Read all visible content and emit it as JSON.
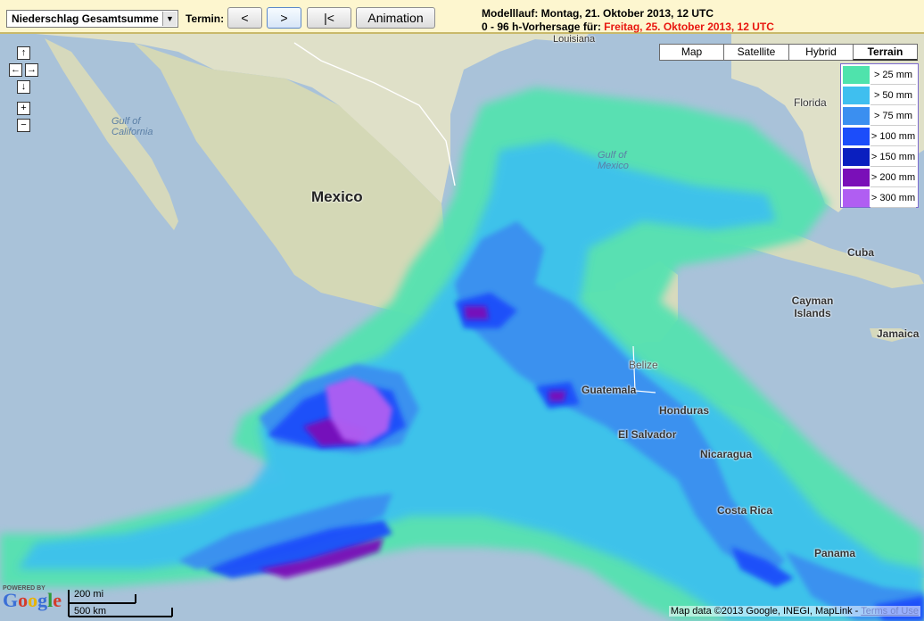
{
  "toolbar": {
    "parameter_select": "Niederschlag Gesamtsumme",
    "termin_label": "Termin:",
    "prev_label": "<",
    "next_label": ">",
    "first_label": "|<",
    "animation_label": "Animation",
    "modelllauf": "Modelllauf: Montag, 21. Oktober 2013, 12 UTC",
    "vorhersage_prefix": "0 - 96 h-Vorhersage für: ",
    "vorhersage_date": "Freitag, 25. Oktober 2013, 12 UTC"
  },
  "map_types": [
    "Map",
    "Satellite",
    "Hybrid",
    "Terrain"
  ],
  "selected_map_type": "Terrain",
  "legend": [
    {
      "label": "> 25 mm",
      "color": "#4fe3ac"
    },
    {
      "label": "> 50 mm",
      "color": "#3fbfef"
    },
    {
      "label": "> 75 mm",
      "color": "#3b8ff0"
    },
    {
      "label": "> 100 mm",
      "color": "#1c4dfa"
    },
    {
      "label": "> 150 mm",
      "color": "#0a1fbf"
    },
    {
      "label": "> 200 mm",
      "color": "#7a0fb8"
    },
    {
      "label": "> 300 mm",
      "color": "#b05ef2"
    }
  ],
  "map_labels": {
    "louisiana": "Louisiana",
    "florida": "Florida",
    "gulf_california": "Gulf of\nCalifornia",
    "gulf_mexico": "Gulf of\nMexico",
    "mexico": "Mexico",
    "cuba": "Cuba",
    "cayman": "Cayman\nIslands",
    "jamaica": "Jamaica",
    "belize": "Belize",
    "guatemala": "Guatemala",
    "honduras": "Honduras",
    "el_salvador": "El Salvador",
    "nicaragua": "Nicaragua",
    "costa_rica": "Costa Rica",
    "panama": "Panama"
  },
  "nav": {
    "up": "↑",
    "left": "←",
    "right": "→",
    "down": "↓",
    "zoom_in": "+",
    "zoom_out": "−"
  },
  "google": {
    "powered": "POWERED BY",
    "word": "Google"
  },
  "scale": {
    "mi": "200 mi",
    "km": "500 km"
  },
  "copyright": {
    "text": "Map data ©2013 Google, INEGI, MapLink - ",
    "terms": "Terms of Use"
  },
  "colors": {
    "land": "#d9dcc2",
    "sea": "#a9c2d9",
    "toolbar_bg": "#fdf6cf",
    "forecast_red": "#e8160f"
  }
}
